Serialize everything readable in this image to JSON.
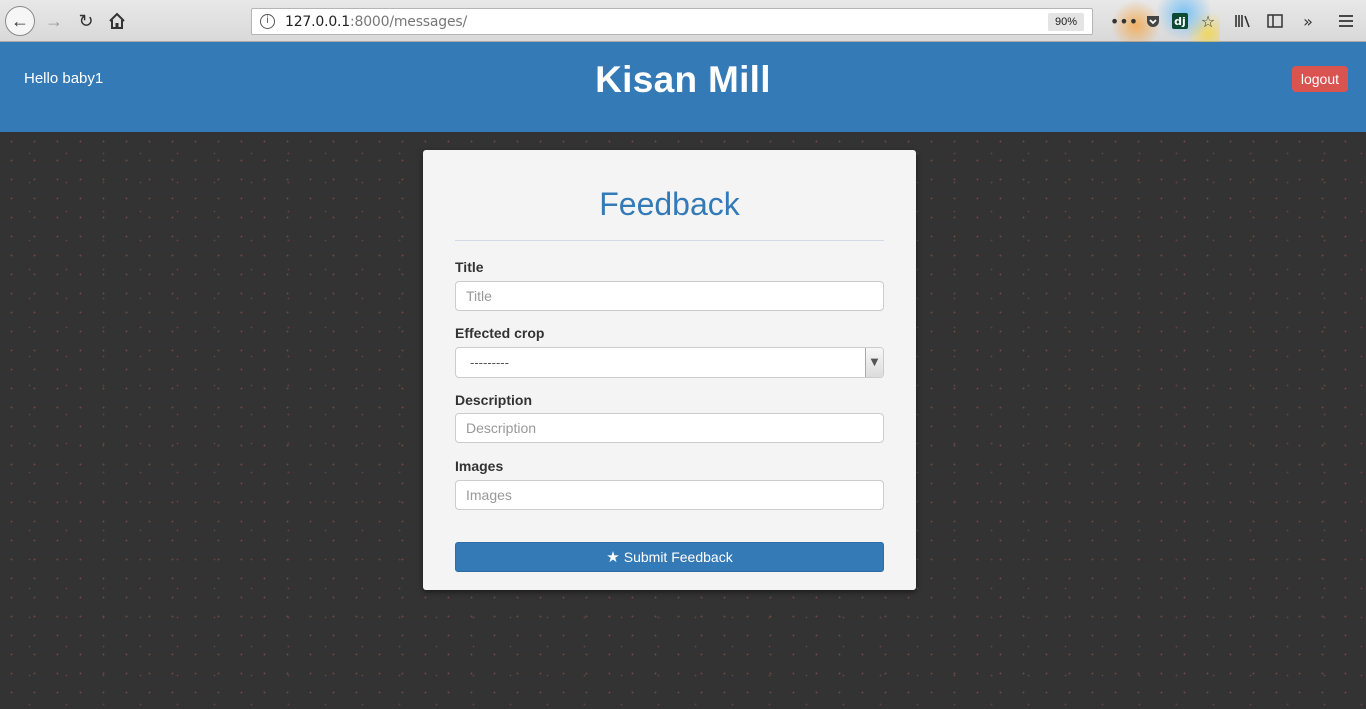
{
  "browser": {
    "url_host": "127.0.0.1",
    "url_rest": ":8000/messages/",
    "zoom": "90%",
    "info_glyph": "i",
    "dj_label": "dj"
  },
  "header": {
    "greeting": "Hello baby1",
    "site_title": "Kisan Mill",
    "logout_label": "logout",
    "color": "#337ab7",
    "logout_color": "#d9534f"
  },
  "form": {
    "title": "Feedback",
    "fields": {
      "title": {
        "label": "Title",
        "placeholder": "Title"
      },
      "crop": {
        "label": "Effected crop",
        "selected": "---------"
      },
      "description": {
        "label": "Description",
        "placeholder": "Description"
      },
      "images": {
        "label": "Images",
        "placeholder": "Images"
      }
    },
    "submit_label": "Submit Feedback"
  }
}
